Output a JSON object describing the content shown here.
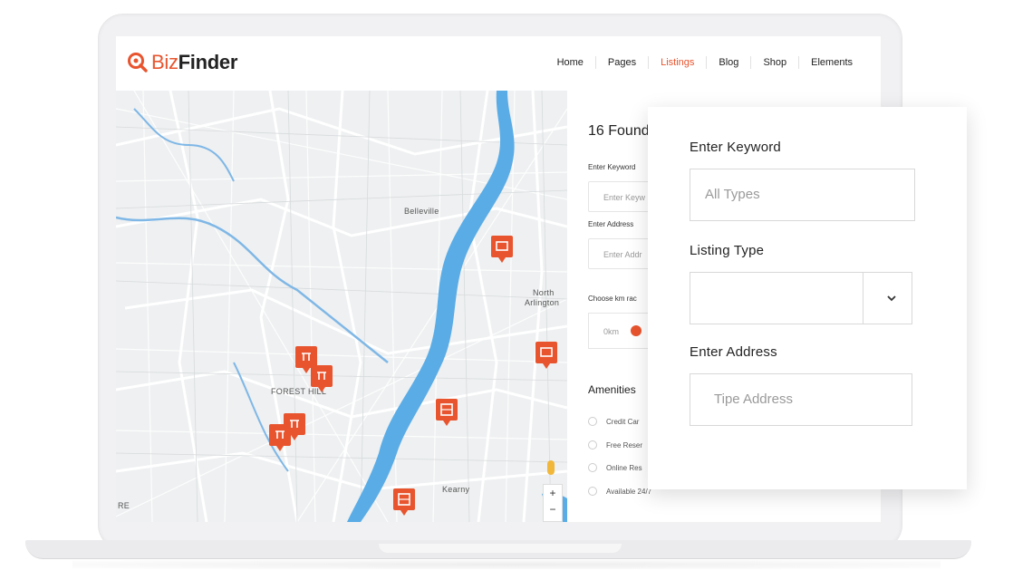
{
  "brand": {
    "prefix": "Biz",
    "name": "Finder",
    "accent": "#e8542e"
  },
  "nav": {
    "items": [
      {
        "label": "Home"
      },
      {
        "label": "Pages"
      },
      {
        "label": "Listings",
        "active": true
      },
      {
        "label": "Blog"
      },
      {
        "label": "Shop"
      },
      {
        "label": "Elements"
      }
    ]
  },
  "map": {
    "labels": {
      "belleville": "Belleville",
      "north_arlington_1": "North",
      "north_arlington_2": "Arlington",
      "forest_hill": "FOREST HILL",
      "kearny": "Kearny",
      "edge": "RE"
    },
    "zoom_in": "+",
    "zoom_out": "−",
    "river_color": "#5aace6",
    "marker_count": 8
  },
  "listing_panel": {
    "count_text": "16 Found",
    "keyword_label": "Enter Keyword",
    "keyword_placeholder": "Enter Keyw",
    "address_label": "Enter Address",
    "address_placeholder": "Enter Addr",
    "radius_label": "Choose km rac",
    "radius_value": "0km",
    "amenities_title": "Amenities",
    "amenities": [
      "Credit Car",
      "Free Reser",
      "Online Res",
      "Available 24/7"
    ]
  },
  "search_popup": {
    "keyword_label": "Enter Keyword",
    "keyword_placeholder": "All Types",
    "listing_type_label": "Listing Type",
    "listing_type_value": "",
    "address_label": "Enter Address",
    "address_placeholder": "Tipe Address"
  }
}
